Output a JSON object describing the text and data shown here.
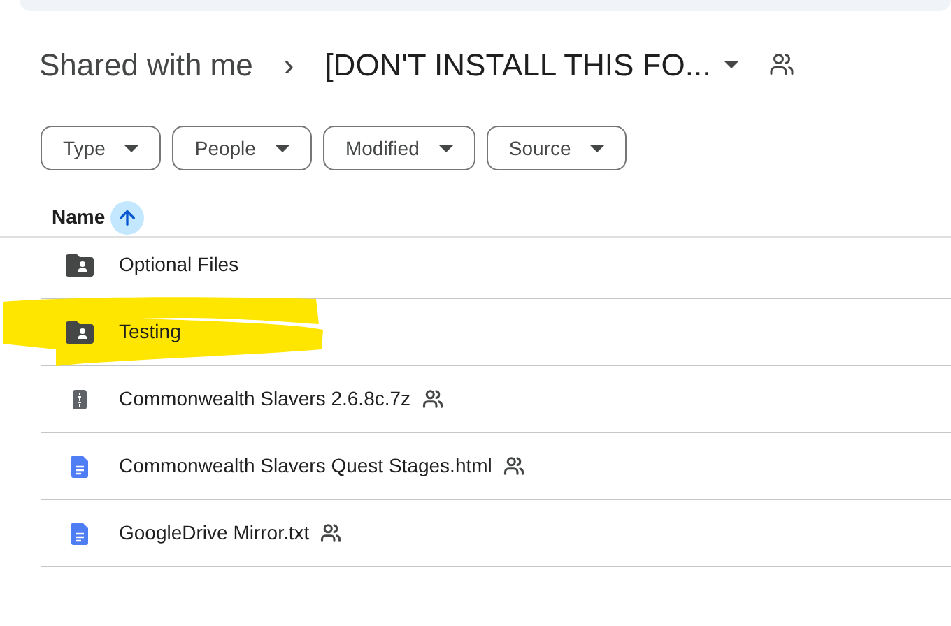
{
  "breadcrumb": {
    "root": "Shared with me",
    "separator": "›",
    "current": "[DON'T INSTALL THIS FO..."
  },
  "filters": [
    {
      "label": "Type"
    },
    {
      "label": "People"
    },
    {
      "label": "Modified"
    },
    {
      "label": "Source"
    }
  ],
  "table": {
    "columns": [
      {
        "label": "Name",
        "sort_ascending": true
      }
    ],
    "rows": [
      {
        "name": "Optional Files",
        "kind": "shared-folder",
        "shared": false,
        "highlighted": false
      },
      {
        "name": "Testing",
        "kind": "shared-folder",
        "shared": false,
        "highlighted": true
      },
      {
        "name": "Commonwealth Slavers 2.6.8c.7z",
        "kind": "archive",
        "shared": true,
        "highlighted": false
      },
      {
        "name": "Commonwealth Slavers Quest Stages.html",
        "kind": "document",
        "shared": true,
        "highlighted": false
      },
      {
        "name": "GoogleDrive Mirror.txt",
        "kind": "document",
        "shared": true,
        "highlighted": false
      }
    ]
  }
}
